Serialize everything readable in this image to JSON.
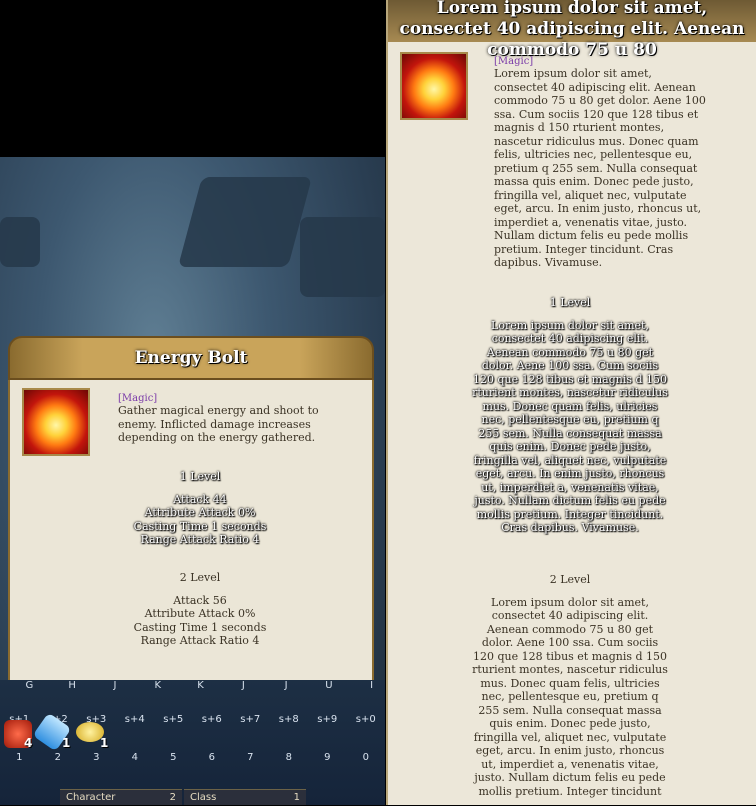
{
  "left_tooltip": {
    "title": "Energy Bolt",
    "tag": "[Magic]",
    "description": "Gather magical energy and shoot to enemy. Inflicted damage increases depending on the energy gathered.",
    "level1": {
      "heading": "1 Level",
      "lines": [
        "Attack 44",
        "Attribute Attack 0%",
        "Casting Time 1 seconds",
        "Range Attack Ratio 4"
      ]
    },
    "level2": {
      "heading": "2 Level",
      "lines": [
        "Attack 56",
        "Attribute Attack 0%",
        "Casting Time 1 seconds",
        "Range Attack Ratio 4"
      ]
    }
  },
  "hotbar": {
    "letters": [
      "G",
      "H",
      "J",
      "K",
      "K",
      "J",
      "J",
      "U",
      "I"
    ],
    "shift_keys": [
      "s+1",
      "s+2",
      "s+3",
      "s+4",
      "s+5",
      "s+6",
      "s+7",
      "s+8",
      "s+9",
      "s+0"
    ],
    "number_keys": [
      "1",
      "2",
      "3",
      "4",
      "5",
      "6",
      "7",
      "8",
      "9",
      "0"
    ],
    "items": [
      {
        "icon": "red-potion-icon",
        "count": "4"
      },
      {
        "icon": "blue-potion-icon",
        "count": "1"
      },
      {
        "icon": "gold-coin-icon",
        "count": "1"
      }
    ],
    "status": [
      {
        "label": "Character",
        "value": "2"
      },
      {
        "label": "Class",
        "value": "1"
      }
    ]
  },
  "right_tooltip": {
    "title": "Lorem ipsum dolor sit amet, consectet 40 adipiscing elit. Aenean commodo 75 u 80",
    "tag": "[Magic]",
    "description": "Lorem ipsum dolor sit amet, consectet 40 adipiscing elit. Aenean commodo 75 u 80 get dolor. Aene 100 ssa. Cum sociis 120 que 128 tibus et magnis d 150 rturient montes, nascetur ridiculus mus. Donec quam felis, ultricies nec, pellentesque eu, pretium q 255 sem. Nulla consequat massa quis enim. Donec pede justo, fringilla vel, aliquet nec, vulputate eget, arcu. In enim justo, rhoncus ut, imperdiet a, venenatis vitae, justo. Nullam dictum felis eu pede mollis pretium. Integer tincidunt. Cras dapibus. Vivamuse.",
    "level1": {
      "heading": "1 Level",
      "text": "Lorem ipsum dolor sit amet, consectet 40 adipiscing elit. Aenean commodo 75 u 80 get dolor. Aene 100 ssa. Cum sociis 120 que 128 tibus et magnis d 150 rturient montes, nascetur ridiculus mus. Donec quam felis, ulricies nec, pellentesque eu, pretium q 255 sem. Nulla consequat massa quis enim. Donec pede justo, fringilla vel, aliquet nec, vulputate eget, arcu. In enim justo, rhoncus ut, imperdiet a, venenatis vitae, justo. Nullam dictum felis eu pede mollis pretium. Integer tincidunt. Cras dapibus. Vivamuse."
    },
    "level2": {
      "heading": "2 Level",
      "text": "Lorem ipsum dolor sit amet, consectet 40 adipiscing elit. Aenean commodo 75 u 80 get dolor. Aene 100 ssa. Cum sociis 120 que 128 tibus et magnis d 150 rturient montes, nascetur ridiculus mus. Donec quam felis, ultricies nec, pellentesque eu, pretium q 255 sem. Nulla consequat massa quis enim. Donec pede justo, fringilla vel, aliquet nec, vulputate eget, arcu. In enim justo, rhoncus ut, imperdiet a, venenatis vitae, justo. Nullam dictum felis eu pede mollis pretium. Integer tincidunt"
    }
  },
  "colors": {
    "tooltip_bg": "#ebe6d7",
    "frame_gold": "#c9a45a",
    "magic_tag": "#7a3aa8"
  }
}
